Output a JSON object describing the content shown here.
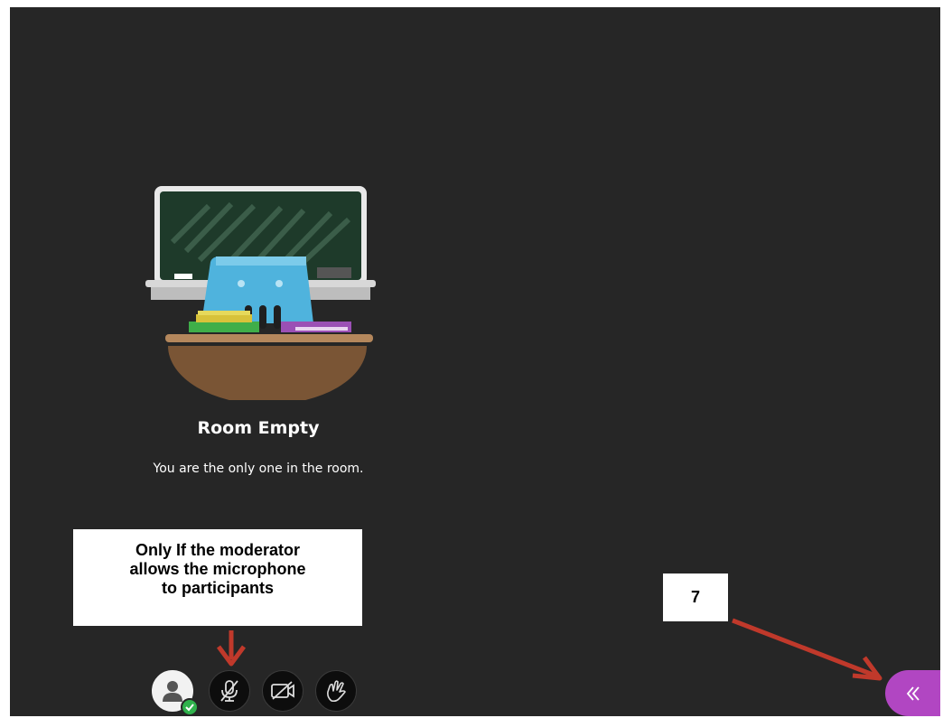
{
  "room": {
    "title": "Room Empty",
    "subtitle": "You are the only one in the room."
  },
  "callouts": {
    "moderator_lines": [
      "Only If the moderator",
      "allows the microphone",
      "to participants"
    ],
    "step_number": "7"
  },
  "controls": {
    "avatar_icon": "user-icon",
    "status_icon": "check-icon",
    "mic_icon": "microphone-muted-icon",
    "camera_icon": "camera-off-icon",
    "hand_icon": "raise-hand-icon",
    "panel_toggle_icon": "double-chevron-left-icon"
  },
  "colors": {
    "background": "#262626",
    "accent": "#b146c2",
    "annotation_arrow": "#c0392b",
    "status_ok": "#2fb24c"
  }
}
